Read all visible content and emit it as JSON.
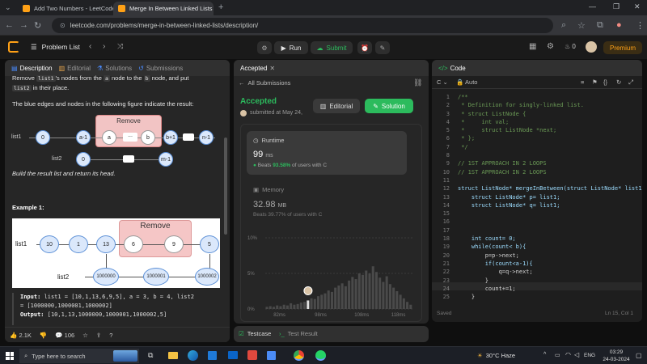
{
  "browser": {
    "tabs": [
      {
        "title": "Add Two Numbers - LeetCode"
      },
      {
        "title": "Merge In Between Linked Lists"
      }
    ],
    "url": "leetcode.com/problems/merge-in-between-linked-lists/description/"
  },
  "lc_header": {
    "problem_list": "Problem List",
    "run": "Run",
    "submit": "Submit",
    "streak": "0",
    "premium": "Premium"
  },
  "description": {
    "tabs": [
      "Description",
      "Editorial",
      "Solutions",
      "Submissions"
    ],
    "intro_a": "Remove ",
    "intro_code1": "list1",
    "intro_b": "'s nodes from the ",
    "intro_code2": "a",
    "intro_c": " node to the ",
    "intro_code3": "b",
    "intro_d": " node, and put",
    "intro_code4": "list2",
    "intro_e": " in their place.",
    "blue_text": "The blue edges and nodes in the following figure indicate the result:",
    "diagram1": {
      "remove": "Remove",
      "list1": "list1",
      "list2": "list2",
      "n0": "0",
      "na1": "a-1",
      "na": "a",
      "ndots": "...",
      "nb": "b",
      "nb1": "b+1",
      "nn1": "n-1",
      "m0": "0",
      "mm1": "m-1"
    },
    "build_text": "Build the result list and return its head.",
    "example_title": "Example 1:",
    "diagram2": {
      "remove": "Remove",
      "list1": "list1",
      "list2": "list2",
      "l1": [
        "10",
        "1",
        "13",
        "6",
        "9",
        "5"
      ],
      "l2": [
        "1000000",
        "1000001",
        "1000002"
      ]
    },
    "input_label": "Input:",
    "input_value": " list1 = [10,1,13,6,9,5], a = 3, b = 4, list2",
    "input_value2": "= [1000000,1000001,1000002]",
    "output_label": "Output:",
    "output_value": " [10,1,13,1000000,1000001,1000002,5]",
    "likes": "2.1K",
    "comments": "106"
  },
  "accepted": {
    "tab": "Accepted",
    "all_submissions": "All Submissions",
    "status": "Accepted",
    "submitted": "submitted at May 24,",
    "editorial": "Editorial",
    "solution": "Solution",
    "runtime_label": "Runtime",
    "runtime_value": "99",
    "runtime_unit": "ms",
    "beats_prefix": "Beats ",
    "runtime_beats": "93.58%",
    "beats_suffix": " of users with C",
    "memory_label": "Memory",
    "memory_value": "32.98",
    "memory_unit": "MB",
    "memory_beats_text": "Beats 39.77% of users with C",
    "chart_y": [
      "10%",
      "5%",
      "0%"
    ],
    "chart_x": [
      "82ms",
      "98ms",
      "108ms",
      "118ms"
    ],
    "testcase": "Testcase",
    "test_result": "Test Result"
  },
  "code": {
    "title": "Code",
    "lang": "C",
    "auto": "Auto",
    "saved": "Saved",
    "cursor": "Ln 15, Col 1",
    "lines": [
      {
        "n": "1",
        "t": "/**",
        "c": "cmt"
      },
      {
        "n": "2",
        "t": " * Definition for singly-linked list.",
        "c": "cmt"
      },
      {
        "n": "3",
        "t": " * struct ListNode {",
        "c": "cmt"
      },
      {
        "n": "4",
        "t": " *     int val;",
        "c": "cmt"
      },
      {
        "n": "5",
        "t": " *     struct ListNode *next;",
        "c": "cmt"
      },
      {
        "n": "6",
        "t": " * };",
        "c": "cmt"
      },
      {
        "n": "7",
        "t": " */",
        "c": "cmt"
      },
      {
        "n": "8",
        "t": "",
        "c": ""
      },
      {
        "n": "9",
        "t": "// 1ST APPROACH IN 2 LOOPS",
        "c": "cmt"
      },
      {
        "n": "10",
        "t": "// 1ST APPROACH IN 2 LOOPS",
        "c": "cmt"
      },
      {
        "n": "11",
        "t": "",
        "c": ""
      },
      {
        "n": "12",
        "t": "struct ListNode* mergeInBetween(struct ListNode* list1,",
        "c": "kw"
      },
      {
        "n": "13",
        "t": "    struct ListNode* p= list1;",
        "c": "kw"
      },
      {
        "n": "14",
        "t": "    struct ListNode* q= list1;",
        "c": "kw"
      },
      {
        "n": "15",
        "t": "",
        "c": ""
      },
      {
        "n": "16",
        "t": "",
        "c": ""
      },
      {
        "n": "17",
        "t": "",
        "c": ""
      },
      {
        "n": "18",
        "t": "    int count= 0;",
        "c": "kw"
      },
      {
        "n": "19",
        "t": "    while(count< b){",
        "c": "kw"
      },
      {
        "n": "20",
        "t": "        p=p->next;",
        "c": ""
      },
      {
        "n": "21",
        "t": "        if(count<a-1){",
        "c": "kw"
      },
      {
        "n": "22",
        "t": "            q=q->next;",
        "c": ""
      },
      {
        "n": "23",
        "t": "        }",
        "c": ""
      },
      {
        "n": "24",
        "t": "        count+=1;",
        "c": ""
      },
      {
        "n": "25",
        "t": "    }",
        "c": ""
      }
    ]
  },
  "taskbar": {
    "search": "Type here to search",
    "weather": "30°C  Haze",
    "lang": "ENG",
    "time": "03:29",
    "date": "24-03-2024"
  },
  "chart_data": {
    "type": "bar",
    "y_ticks": [
      "10%",
      "5%",
      "0%"
    ],
    "x_ticks": [
      "82ms",
      "98ms",
      "108ms",
      "118ms"
    ],
    "ylim": [
      0,
      10
    ],
    "values": [
      0.3,
      0.4,
      0.3,
      0.5,
      0.4,
      0.6,
      0.5,
      0.8,
      0.6,
      0.7,
      0.9,
      1.0,
      1.2,
      1.5,
      1.4,
      1.8,
      2.0,
      2.2,
      2.6,
      2.4,
      3.0,
      3.3,
      3.6,
      3.2,
      4.0,
      4.5,
      4.2,
      5.0,
      4.8,
      5.4,
      5.0,
      6.0,
      5.2,
      4.4,
      3.8,
      4.6,
      3.5,
      3.0,
      2.5,
      2.0,
      1.5,
      1.0,
      0.6
    ],
    "highlight_index": 12
  },
  "colors": {
    "accent": "#ffa116",
    "success": "#2cbb5d",
    "remove_box": "#f2c4c4"
  }
}
